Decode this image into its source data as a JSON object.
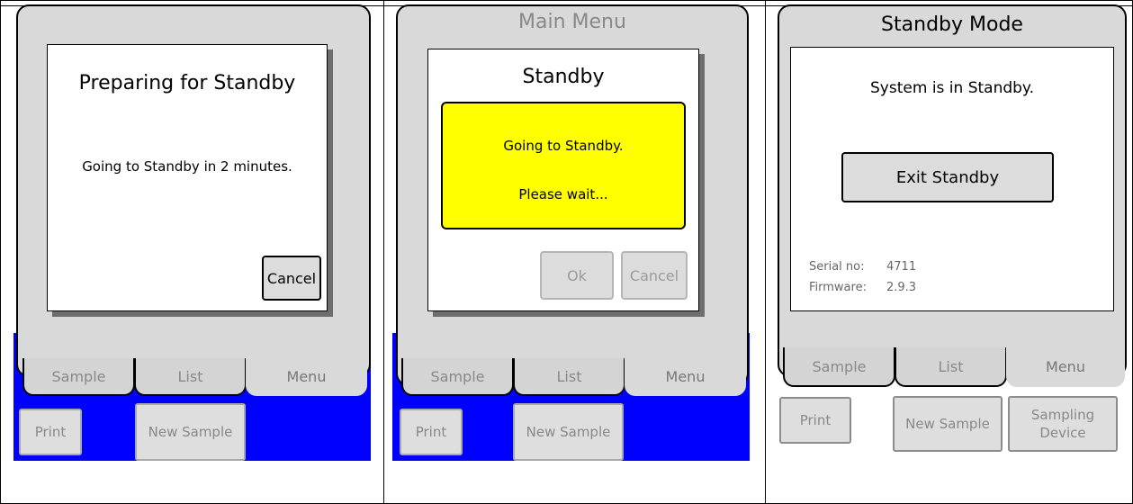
{
  "panel1": {
    "dialog_title": "Preparing for Standby",
    "message": "Going to Standby in 2 minutes.",
    "cancel_label": "Cancel",
    "tabs": [
      {
        "label": "Sample"
      },
      {
        "label": "List"
      },
      {
        "label": "Menu"
      }
    ],
    "print_label": "Print",
    "new_sample_label": "New Sample"
  },
  "panel2": {
    "screen_title": "Main Menu",
    "dialog_title": "Standby",
    "message1": "Going to Standby.",
    "message2": "Please wait...",
    "ok_label": "Ok",
    "cancel_label": "Cancel",
    "tabs": [
      {
        "label": "Sample"
      },
      {
        "label": "List"
      },
      {
        "label": "Menu"
      }
    ],
    "print_label": "Print",
    "new_sample_label": "New Sample"
  },
  "panel3": {
    "screen_title": "Standby Mode",
    "status": "System is in Standby.",
    "exit_label": "Exit Standby",
    "serial_label": "Serial no:",
    "serial_value": "4711",
    "firmware_label": "Firmware:",
    "firmware_value": "2.9.3",
    "tabs": [
      {
        "label": "Sample"
      },
      {
        "label": "List"
      },
      {
        "label": "Menu"
      }
    ],
    "print_label": "Print",
    "new_sample_label": "New Sample",
    "sampling_device_label": "Sampling Device"
  },
  "colors": {
    "blue": "#0000ff",
    "yellow": "#ffff00",
    "device_gray": "#d9d9d9",
    "dialog_white": "#ffffff"
  }
}
